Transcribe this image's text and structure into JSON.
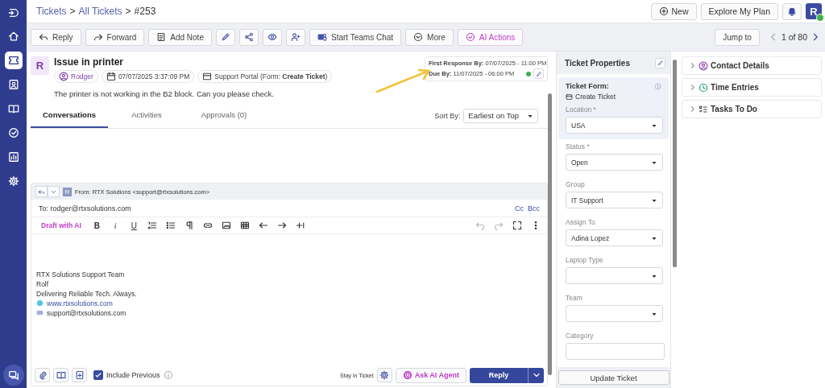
{
  "breadcrumb": [
    {
      "label": "Tickets",
      "link": true
    },
    {
      "label": "All Tickets",
      "link": true
    },
    {
      "label": "#253",
      "link": false
    }
  ],
  "separator": ">",
  "header_actions": {
    "new_label": "New",
    "plan_label": "Explore My Plan",
    "avatar": "R",
    "online": true
  },
  "sidebar": {
    "items": [
      {
        "selected": false
      },
      {
        "selected": true
      },
      {
        "selected": false
      },
      {
        "selected": false
      },
      {
        "selected": false
      },
      {
        "selected": false
      },
      {
        "selected": false
      }
    ]
  },
  "toolbar": [
    {
      "kind": "text",
      "label": "Reply"
    },
    {
      "kind": "text",
      "label": "Forward"
    },
    {
      "kind": "text",
      "label": "Add Note"
    },
    {
      "kind": "icon"
    },
    {
      "kind": "icon"
    },
    {
      "kind": "icon"
    },
    {
      "kind": "icon"
    },
    {
      "kind": "text",
      "label": "Start Teams Chat"
    },
    {
      "kind": "text",
      "label": "More"
    },
    {
      "kind": "ai",
      "label": "AI Actions"
    }
  ],
  "jump_to": "Jump to",
  "pager": "1 of 80",
  "ticket": {
    "avatar": "R",
    "title": "Issue in printer",
    "requester": "Rodger",
    "created": "07/07/2025 3:37:09 PM",
    "source": "Support Portal (Form: **Create Ticket**)",
    "description": "The printer is not working in the B2 block. Can you please check.",
    "sla": {
      "first_label": "First Response By:",
      "first_value": "07/07/2025 - 11:00 PM",
      "due_label": "Due By:",
      "due_value": "11/07/2025 - 06:00 PM"
    }
  },
  "tabs": [
    {
      "label": "Conversations",
      "selected": true
    },
    {
      "label": "Activities",
      "selected": false
    },
    {
      "label": "Approvals (0)",
      "selected": false
    }
  ],
  "sort": {
    "label": "Sort By:",
    "value": "Earliest on Top"
  },
  "composer": {
    "from_avatar": "R",
    "from": "From:  RTX Solutions <support@rtxsolutions.com>",
    "to": "To: rodger@rtxsolutions.com",
    "cc": "Cc",
    "bcc": "Bcc",
    "tools": [
      {
        "kind": "ai",
        "label": "Draft with AI"
      },
      {
        "kind": "bold",
        "label": "B"
      },
      {
        "kind": "italic",
        "label": "i"
      },
      {
        "kind": "underline",
        "label": "U"
      },
      {
        "kind": "icon"
      },
      {
        "kind": "icon"
      },
      {
        "kind": "icon"
      },
      {
        "kind": "icon"
      },
      {
        "kind": "icon"
      },
      {
        "kind": "icon"
      },
      {
        "kind": "icon"
      },
      {
        "kind": "icon"
      },
      {
        "kind": "icon"
      },
      {
        "kind": "icon"
      }
    ],
    "signature": [
      {
        "kind": "text",
        "text": "RTX Solutions Support Team"
      },
      {
        "kind": "text",
        "text": "Rolf"
      },
      {
        "kind": "text",
        "text": "Delivering Reliable Tech. Always."
      },
      {
        "kind": "link",
        "text": "www.rtxsolutions.com"
      },
      {
        "kind": "email",
        "text": "support@rtxsolutions.com"
      }
    ],
    "include_previous": {
      "label": "Include Previous",
      "checked": true
    },
    "stay_label": "Stay in Ticket",
    "ai_agent": "Ask AI Agent",
    "reply": "Reply"
  },
  "properties": {
    "title": "Ticket Properties",
    "form_label": "Ticket Form:",
    "form_value": "Create Ticket",
    "form_fields": [
      {
        "label": "Location *",
        "kind": "select",
        "value": "USA"
      }
    ],
    "fields": [
      {
        "label": "Status *",
        "kind": "select",
        "value": "Open"
      },
      {
        "label": "Group",
        "kind": "select",
        "value": "IT Support"
      },
      {
        "label": "Assign To",
        "kind": "select",
        "value": "Adina Lopez"
      },
      {
        "label": "Laptop Type",
        "kind": "select"
      },
      {
        "label": "Team",
        "kind": "select"
      },
      {
        "label": "Category",
        "kind": "text"
      }
    ],
    "update": "Update Ticket"
  },
  "sections": [
    {
      "label": "Contact Details",
      "expanded": false
    },
    {
      "label": "Time Entries",
      "expanded": false
    },
    {
      "label": "Tasks To Do",
      "expanded": false
    }
  ]
}
